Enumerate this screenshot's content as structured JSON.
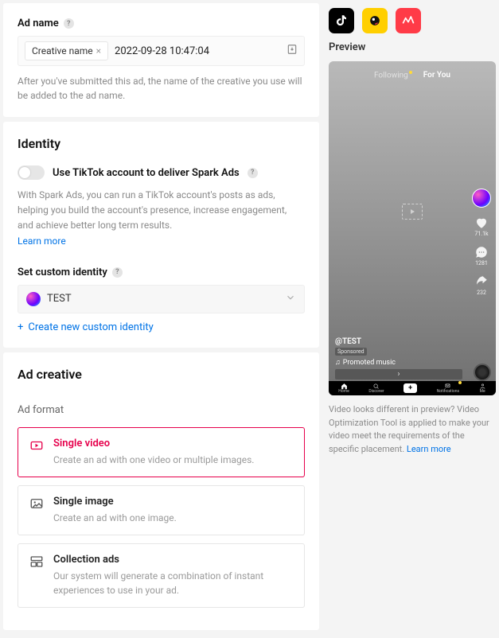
{
  "adname": {
    "label": "Ad name",
    "chip": "Creative name",
    "value": "2022-09-28 10:47:04",
    "hint": "After you've submitted this ad, the name of the creative you use will be added to the ad name."
  },
  "identity": {
    "title": "Identity",
    "toggle_label": "Use TikTok account to deliver Spark Ads",
    "spark_desc": "With Spark Ads, you can run a TikTok account's posts as ads, helping you build the account's presence, increase engagement, and achieve better long term results.",
    "learn_more": "Learn more",
    "custom_label": "Set custom identity",
    "selected": "TEST",
    "create_new": "Create new custom identity"
  },
  "creative": {
    "title": "Ad creative",
    "format_label": "Ad format",
    "options": [
      {
        "title": "Single video",
        "desc": "Create an ad with one video or multiple images."
      },
      {
        "title": "Single image",
        "desc": "Create an ad with one image."
      },
      {
        "title": "Collection ads",
        "desc": "Our system will generate a combination of instant experiences to use in your ad."
      }
    ]
  },
  "preview": {
    "label": "Preview",
    "tabs": {
      "following": "Following",
      "foryou": "For You"
    },
    "stats": {
      "likes": "71.1k",
      "comments": "1281",
      "shares": "232"
    },
    "handle": "@TEST",
    "sponsored": "Sponsored",
    "music": "Promoted music",
    "cta_arrow": "›",
    "nav": {
      "home": "Home",
      "discover": "Discover",
      "notifications": "Notifications",
      "me": "Me"
    },
    "note_prefix": "Video looks different in preview? Video Optimization Tool is applied to make your video meet the requirements of the specific placement. ",
    "note_link": "Learn more"
  }
}
